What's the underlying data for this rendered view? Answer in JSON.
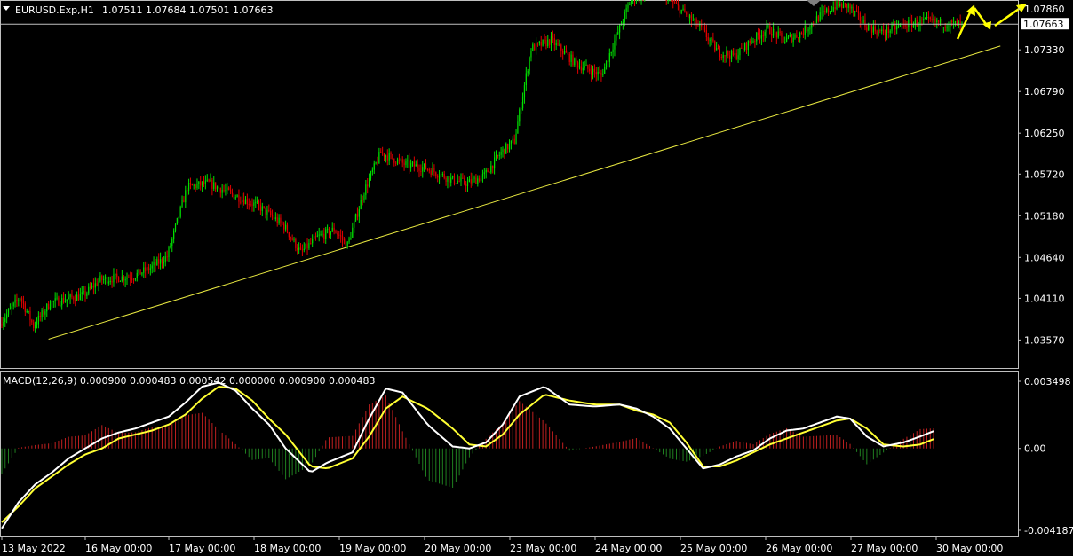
{
  "header": {
    "symbol": "EURUSD.Exp,H1",
    "ohlc": "1.07511 1.07684 1.07501 1.07663",
    "menu_icon": "triangle-down-icon"
  },
  "macd_header": {
    "label": "MACD(12,26,9) 0.000900 0.000483 0.000542 0.000000 0.000900 0.000483"
  },
  "colors": {
    "background": "#000000",
    "bull": "#00e000",
    "bear": "#e00000",
    "trendline": "#e8e840",
    "arrow": "#ffff00",
    "macd_line": "#ffffff",
    "signal_line": "#ffff33",
    "hist_pos": "#c02020",
    "hist_neg": "#208020",
    "text": "#ffffff"
  },
  "chart_data": [
    {
      "type": "candlestick",
      "name": "EURUSD.Exp,H1",
      "ylim": [
        1.0331,
        1.0793
      ],
      "y_ticks": [
        "1.07860",
        "1.07330",
        "1.06790",
        "1.06250",
        "1.05720",
        "1.05180",
        "1.04640",
        "1.04110",
        "1.03570"
      ],
      "current_price": "1.07663",
      "x_labels": [
        "13 May 2022",
        "16 May 00:00",
        "17 May 00:00",
        "18 May 00:00",
        "19 May 00:00",
        "20 May 00:00",
        "23 May 00:00",
        "24 May 00:00",
        "25 May 00:00",
        "26 May 00:00",
        "27 May 00:00",
        "30 May 00:00"
      ],
      "anchors": [
        [
          0,
          1.0378
        ],
        [
          12,
          1.0413
        ],
        [
          20,
          1.0375
        ],
        [
          30,
          1.0405
        ],
        [
          50,
          1.0415
        ],
        [
          60,
          1.0435
        ],
        [
          80,
          1.044
        ],
        [
          90,
          1.045
        ],
        [
          100,
          1.0465
        ],
        [
          112,
          1.0555
        ],
        [
          125,
          1.056
        ],
        [
          140,
          1.0545
        ],
        [
          155,
          1.053
        ],
        [
          170,
          1.0505
        ],
        [
          180,
          1.047
        ],
        [
          190,
          1.049
        ],
        [
          200,
          1.05
        ],
        [
          208,
          1.048
        ],
        [
          218,
          1.055
        ],
        [
          228,
          1.06
        ],
        [
          242,
          1.0585
        ],
        [
          255,
          1.058
        ],
        [
          265,
          1.057
        ],
        [
          270,
          1.0565
        ],
        [
          280,
          1.056
        ],
        [
          290,
          1.057
        ],
        [
          300,
          1.06
        ],
        [
          308,
          1.0615
        ],
        [
          318,
          1.0735
        ],
        [
          330,
          1.0745
        ],
        [
          345,
          1.0715
        ],
        [
          360,
          1.07
        ],
        [
          378,
          1.08
        ],
        [
          395,
          1.081
        ],
        [
          405,
          1.079
        ],
        [
          420,
          1.076
        ],
        [
          430,
          1.073
        ],
        [
          440,
          1.0725
        ],
        [
          450,
          1.0745
        ],
        [
          460,
          1.076
        ],
        [
          470,
          1.0745
        ],
        [
          480,
          1.0755
        ],
        [
          490,
          1.0775
        ],
        [
          500,
          1.079
        ],
        [
          508,
          1.079
        ],
        [
          518,
          1.0765
        ],
        [
          528,
          1.0755
        ],
        [
          540,
          1.0765
        ],
        [
          555,
          1.077
        ],
        [
          575,
          1.0765
        ]
      ],
      "trendline": [
        [
          28,
          1.0358
        ],
        [
          598,
          1.0738
        ]
      ]
    },
    {
      "type": "macd",
      "name": "MACD(12,26,9)",
      "values": [
        "0.000900",
        "0.000483",
        "0.000542",
        "0.000000",
        "0.000900",
        "0.000483"
      ],
      "ylim": [
        -0.004187,
        0.003498
      ],
      "y_ticks": [
        "0.003498",
        "0.00",
        "-0.004187"
      ],
      "macd_series": [
        [
          0,
          -0.004
        ],
        [
          10,
          -0.0027
        ],
        [
          20,
          -0.0018
        ],
        [
          30,
          -0.0012
        ],
        [
          40,
          -0.0005
        ],
        [
          50,
          0.0
        ],
        [
          60,
          0.0005
        ],
        [
          70,
          0.0008
        ],
        [
          80,
          0.001
        ],
        [
          90,
          0.0013
        ],
        [
          100,
          0.0016
        ],
        [
          110,
          0.0023
        ],
        [
          120,
          0.0031
        ],
        [
          130,
          0.0033
        ],
        [
          140,
          0.0029
        ],
        [
          150,
          0.002
        ],
        [
          160,
          0.0012
        ],
        [
          170,
          0.0
        ],
        [
          185,
          -0.0012
        ],
        [
          195,
          -0.0007
        ],
        [
          210,
          -0.0002
        ],
        [
          220,
          0.0015
        ],
        [
          230,
          0.003
        ],
        [
          240,
          0.0028
        ],
        [
          255,
          0.0012
        ],
        [
          270,
          0.0001
        ],
        [
          280,
          0.0
        ],
        [
          290,
          0.0003
        ],
        [
          300,
          0.0012
        ],
        [
          310,
          0.0026
        ],
        [
          325,
          0.0031
        ],
        [
          340,
          0.0022
        ],
        [
          355,
          0.0021
        ],
        [
          370,
          0.0022
        ],
        [
          380,
          0.002
        ],
        [
          390,
          0.0016
        ],
        [
          400,
          0.001
        ],
        [
          410,
          0.0
        ],
        [
          420,
          -0.001
        ],
        [
          430,
          -0.0008
        ],
        [
          440,
          -0.0004
        ],
        [
          450,
          -0.0001
        ],
        [
          460,
          0.0005
        ],
        [
          470,
          0.0009
        ],
        [
          480,
          0.001
        ],
        [
          490,
          0.0013
        ],
        [
          500,
          0.0016
        ],
        [
          508,
          0.0015
        ],
        [
          518,
          0.0006
        ],
        [
          528,
          0.0001
        ],
        [
          540,
          0.0003
        ],
        [
          550,
          0.0006
        ],
        [
          559,
          0.0009
        ]
      ],
      "signal_series": [
        [
          0,
          -0.0037
        ],
        [
          10,
          -0.0029
        ],
        [
          20,
          -0.002
        ],
        [
          30,
          -0.0014
        ],
        [
          40,
          -0.0008
        ],
        [
          50,
          -0.0003
        ],
        [
          60,
          0.0
        ],
        [
          70,
          0.0005
        ],
        [
          80,
          0.0007
        ],
        [
          90,
          0.0009
        ],
        [
          100,
          0.0012
        ],
        [
          110,
          0.0017
        ],
        [
          120,
          0.0025
        ],
        [
          130,
          0.0031
        ],
        [
          140,
          0.003
        ],
        [
          150,
          0.0024
        ],
        [
          160,
          0.0015
        ],
        [
          170,
          0.0007
        ],
        [
          185,
          -0.0009
        ],
        [
          195,
          -0.001
        ],
        [
          210,
          -0.0005
        ],
        [
          220,
          0.0006
        ],
        [
          230,
          0.002
        ],
        [
          240,
          0.0026
        ],
        [
          255,
          0.002
        ],
        [
          270,
          0.001
        ],
        [
          280,
          0.0002
        ],
        [
          290,
          0.0001
        ],
        [
          300,
          0.0007
        ],
        [
          310,
          0.0017
        ],
        [
          325,
          0.0027
        ],
        [
          340,
          0.0024
        ],
        [
          355,
          0.0022
        ],
        [
          370,
          0.0022
        ],
        [
          380,
          0.0019
        ],
        [
          390,
          0.0017
        ],
        [
          400,
          0.0013
        ],
        [
          410,
          0.0003
        ],
        [
          420,
          -0.0009
        ],
        [
          430,
          -0.0009
        ],
        [
          440,
          -0.0006
        ],
        [
          450,
          -0.0002
        ],
        [
          460,
          0.0002
        ],
        [
          470,
          0.0005
        ],
        [
          480,
          0.0008
        ],
        [
          490,
          0.0011
        ],
        [
          500,
          0.0014
        ],
        [
          508,
          0.0015
        ],
        [
          518,
          0.001
        ],
        [
          528,
          0.0002
        ],
        [
          540,
          0.0001
        ],
        [
          550,
          0.0002
        ],
        [
          559,
          0.0005
        ]
      ]
    }
  ]
}
